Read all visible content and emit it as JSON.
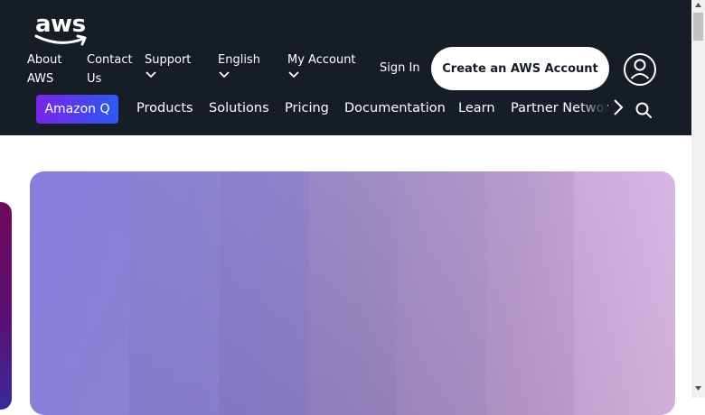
{
  "brand": {
    "logo_text": "aws"
  },
  "utility_nav": {
    "about": [
      "About",
      "AWS"
    ],
    "contact": [
      "Contact",
      "Us"
    ],
    "support": "Support",
    "language": "English",
    "my_account": "My Account",
    "sign_in": "Sign In",
    "create_account": "Create an AWS Account"
  },
  "main_nav": {
    "amazon_q": "Amazon Q",
    "items": [
      "Products",
      "Solutions",
      "Pricing",
      "Documentation",
      "Learn",
      "Partner Network"
    ]
  },
  "icons": {
    "user": "user-circle-icon",
    "search": "search-icon",
    "next": "chevron-right-icon",
    "dropdown": "chevron-down-icon"
  },
  "colors": {
    "header_bg": "#161d26",
    "accent_gradient": [
      "#7a26e6",
      "#2a5cf5"
    ],
    "hero_gradient": [
      "#8a82d8",
      "#d4b6e0"
    ]
  }
}
